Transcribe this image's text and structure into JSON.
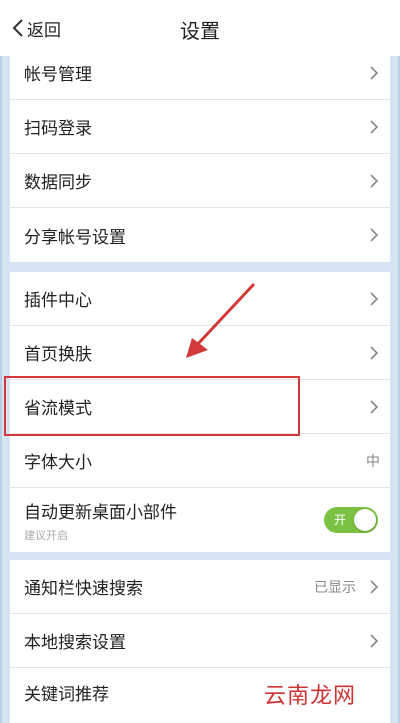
{
  "header": {
    "back_label": "返回",
    "title": "设置"
  },
  "group1": [
    {
      "label": "帐号管理"
    },
    {
      "label": "扫码登录"
    },
    {
      "label": "数据同步"
    },
    {
      "label": "分享帐号设置"
    }
  ],
  "group2": {
    "plugin_center": "插件中心",
    "homepage_skin": "首页换肤",
    "data_saver": "省流模式",
    "font_size": "字体大小",
    "font_size_value": "中",
    "auto_update_widget": "自动更新桌面小部件",
    "auto_update_widget_sub": "建议开启",
    "toggle_label": "开",
    "toggle_on": true
  },
  "group3": {
    "notification_search": "通知栏快速搜索",
    "notification_search_value": "已显示",
    "local_search": "本地搜索设置",
    "keyword_recommend": "关键词推荐"
  },
  "watermark": "云南龙网",
  "colors": {
    "background": "#d6e3f0",
    "toggle_on": "#7cc242",
    "highlight": "#d23a3a"
  }
}
